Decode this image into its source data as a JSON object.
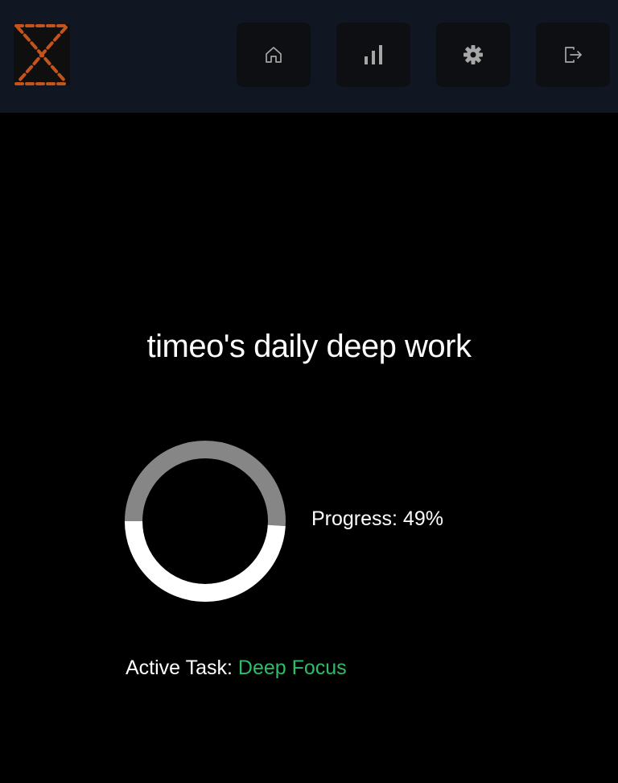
{
  "header": {
    "logo_icon": "hourglass-x-logo",
    "nav": [
      {
        "icon": "home-icon"
      },
      {
        "icon": "bar-chart-icon"
      },
      {
        "icon": "gear-icon"
      },
      {
        "icon": "logout-icon"
      }
    ]
  },
  "main": {
    "title": "timeo's daily deep work",
    "progress": {
      "label": "Progress: 49%",
      "fraction": 0.49,
      "track_color": "#868686",
      "fill_color": "#ffffff"
    },
    "active_task": {
      "label": "Active Task:",
      "name": "Deep Focus",
      "name_color": "#2ebd67"
    }
  },
  "colors": {
    "background": "#000000",
    "topbar": "#111722",
    "button": "#0d0f13",
    "icon": "#a6a6a6",
    "logo": "#c4541c"
  }
}
